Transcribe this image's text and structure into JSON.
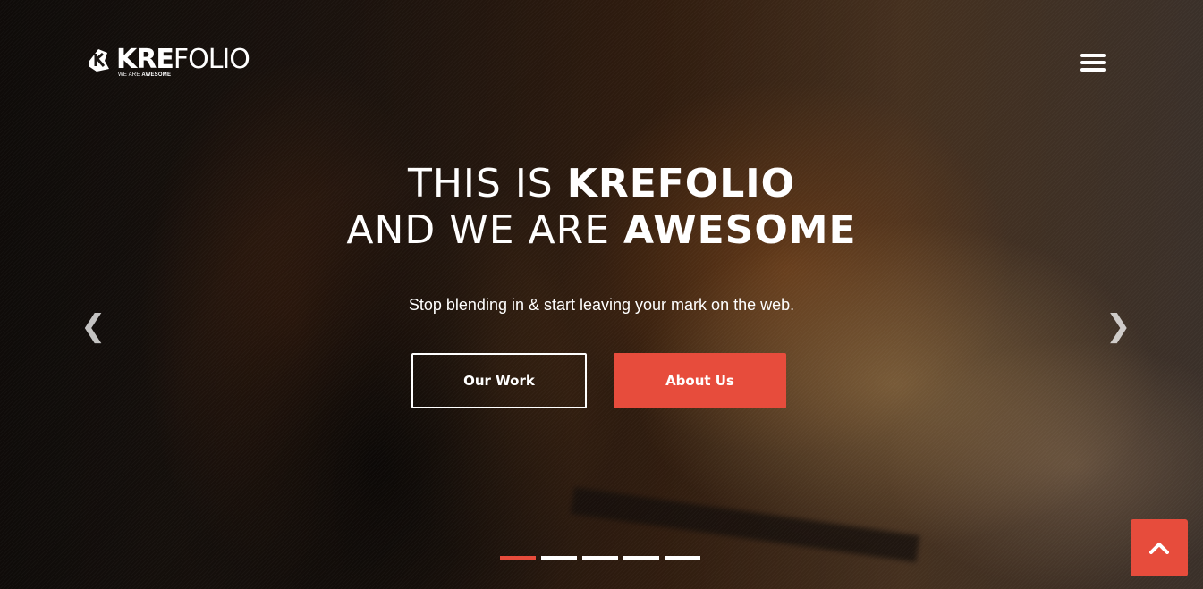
{
  "brand": {
    "word_bold": "KRE",
    "word_light": "FOLIO",
    "tagline_light": "WE ARE ",
    "tagline_bold": "AWESOME"
  },
  "hero": {
    "line1_light": "THIS IS ",
    "line1_bold": "KREFOLIO",
    "line2_light": "AND WE ARE ",
    "line2_bold": "AWESOME",
    "subtitle": "Stop blending in & start leaving your mark on the web.",
    "primary_button": "Our Work",
    "secondary_button": "About Us"
  },
  "slider": {
    "prev_arrow": "❮",
    "next_arrow": "❯",
    "slide_count": 5,
    "active_index": 0
  },
  "colors": {
    "accent": "#e74c3c",
    "text": "#ffffff"
  },
  "icons": {
    "menu": "hamburger-icon",
    "back_to_top": "chevron-up-icon",
    "logo": "krefolio-logo-icon"
  }
}
